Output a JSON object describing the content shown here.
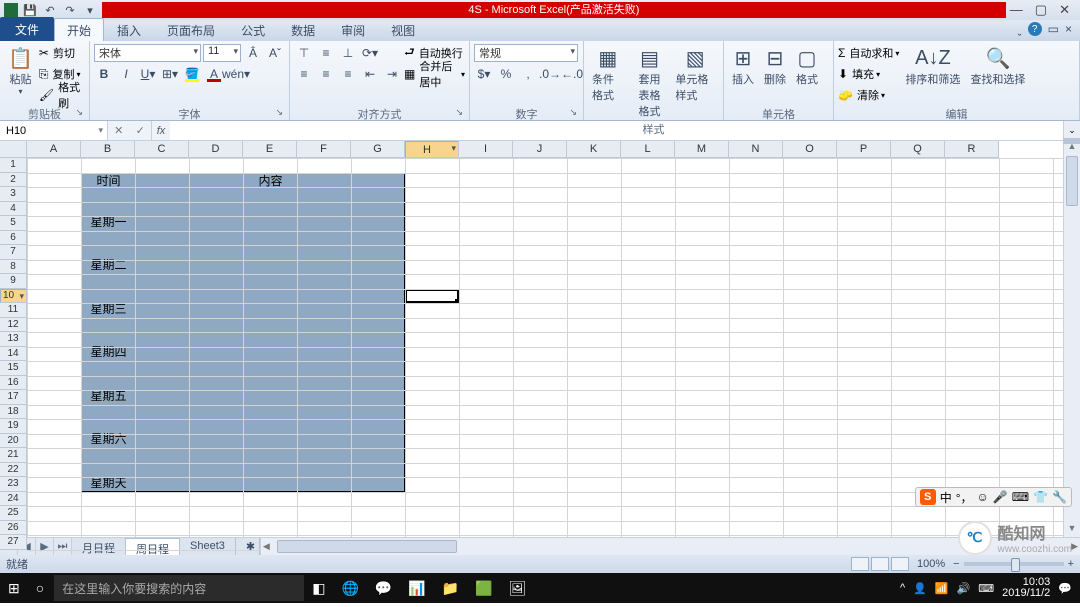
{
  "title": "4S - Microsoft Excel(产品激活失败)",
  "tabs": {
    "file": "文件",
    "items": [
      "开始",
      "插入",
      "页面布局",
      "公式",
      "数据",
      "审阅",
      "视图"
    ],
    "active": 0
  },
  "ribbon": {
    "clipboard": {
      "label": "剪贴板",
      "paste": "粘贴",
      "cut": "剪切",
      "copy": "复制",
      "format_painter": "格式刷"
    },
    "font": {
      "label": "字体",
      "name": "宋体",
      "size": "11"
    },
    "alignment": {
      "label": "对齐方式",
      "wrap": "自动换行",
      "merge": "合并后居中"
    },
    "number": {
      "label": "数字",
      "format": "常规"
    },
    "styles": {
      "label": "样式",
      "cond": "条件格式",
      "table": "套用\n表格格式",
      "cell": "单元格样式"
    },
    "cells": {
      "label": "单元格",
      "insert": "插入",
      "delete": "删除",
      "format": "格式"
    },
    "editing": {
      "label": "编辑",
      "autosum": "自动求和",
      "fill": "填充",
      "clear": "清除",
      "sort": "排序和筛选",
      "find": "查找和选择"
    }
  },
  "name_box": "H10",
  "columns": [
    "A",
    "B",
    "C",
    "D",
    "E",
    "F",
    "G",
    "H",
    "I",
    "J",
    "K",
    "L",
    "M",
    "N",
    "O",
    "P",
    "Q",
    "R"
  ],
  "row_count": 27,
  "active": {
    "col": "H",
    "row": 10
  },
  "table": {
    "header_time": "时间",
    "header_content": "内容",
    "days": [
      "星期一",
      "星期二",
      "星期三",
      "星期四",
      "星期五",
      "星期六",
      "星期天"
    ]
  },
  "sheets": {
    "items": [
      "月日程",
      "周日程",
      "Sheet3"
    ],
    "active": 1
  },
  "status": {
    "ready": "就绪",
    "zoom": "100%"
  },
  "taskbar": {
    "search_placeholder": "在这里输入你要搜索的内容",
    "date": "2019/11/2",
    "time": "10:03"
  },
  "ime": {
    "logo": "S",
    "lang": "中",
    "punct": "°，"
  },
  "watermark": {
    "name": "酷知网",
    "url": "www.coozhi.com"
  }
}
